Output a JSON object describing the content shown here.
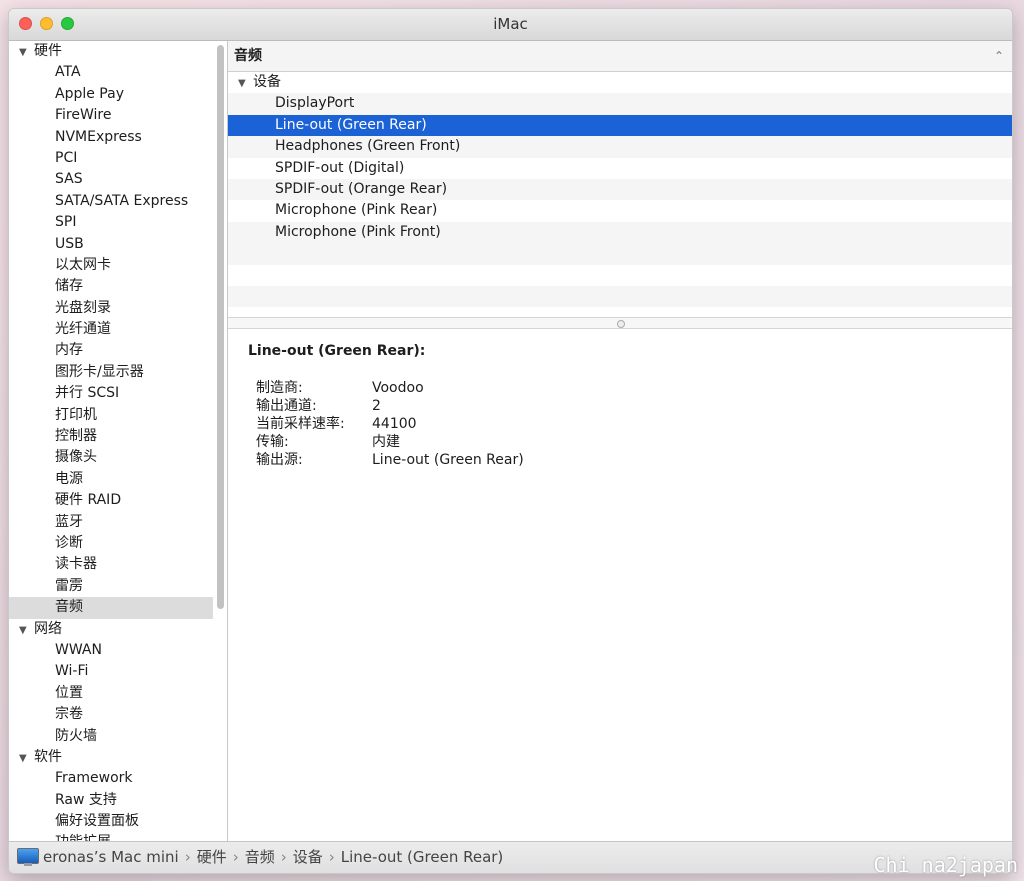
{
  "window": {
    "title": "iMac"
  },
  "sidebar": {
    "groups": [
      {
        "label": "硬件",
        "items": [
          "ATA",
          "Apple Pay",
          "FireWire",
          "NVMExpress",
          "PCI",
          "SAS",
          "SATA/SATA Express",
          "SPI",
          "USB",
          "以太网卡",
          "储存",
          "光盘刻录",
          "光纤通道",
          "内存",
          "图形卡/显示器",
          "并行 SCSI",
          "打印机",
          "控制器",
          "摄像头",
          "电源",
          "硬件 RAID",
          "蓝牙",
          "诊断",
          "读卡器",
          "雷雳",
          "音频"
        ]
      },
      {
        "label": "网络",
        "items": [
          "WWAN",
          "Wi-Fi",
          "位置",
          "宗卷",
          "防火墙"
        ]
      },
      {
        "label": "软件",
        "items": [
          "Framework",
          "Raw 支持",
          "偏好设置面板",
          "功能扩展"
        ]
      }
    ],
    "selected_item": "音频"
  },
  "main": {
    "section_title": "音频",
    "device_group": "设备",
    "devices": [
      "DisplayPort",
      "Line-out (Green Rear)",
      "Headphones (Green Front)",
      "SPDIF-out (Digital)",
      "SPDIF-out (Orange Rear)",
      "Microphone (Pink Rear)",
      "Microphone (Pink Front)"
    ],
    "selected_device": "Line-out (Green Rear)",
    "detail": {
      "title": "Line-out (Green Rear):",
      "properties": [
        {
          "label": "制造商:",
          "value": "Voodoo"
        },
        {
          "label": "输出通道:",
          "value": "2"
        },
        {
          "label": "当前采样速率:",
          "value": "44100"
        },
        {
          "label": "传输:",
          "value": "内建"
        },
        {
          "label": "输出源:",
          "value": "Line-out (Green Rear)"
        }
      ]
    }
  },
  "statusbar": {
    "path": [
      "eronas’s Mac mini",
      "硬件",
      "音频",
      "设备",
      "Line-out (Green Rear)"
    ],
    "separator": "›"
  },
  "watermark": "Chi na2japan",
  "colors": {
    "selection": "#1a62d6",
    "sidebar_selection": "#dcdcdc"
  },
  "icons": {
    "group_toggle": "disclosure-triangle-down-icon",
    "computer": "imac-icon"
  }
}
